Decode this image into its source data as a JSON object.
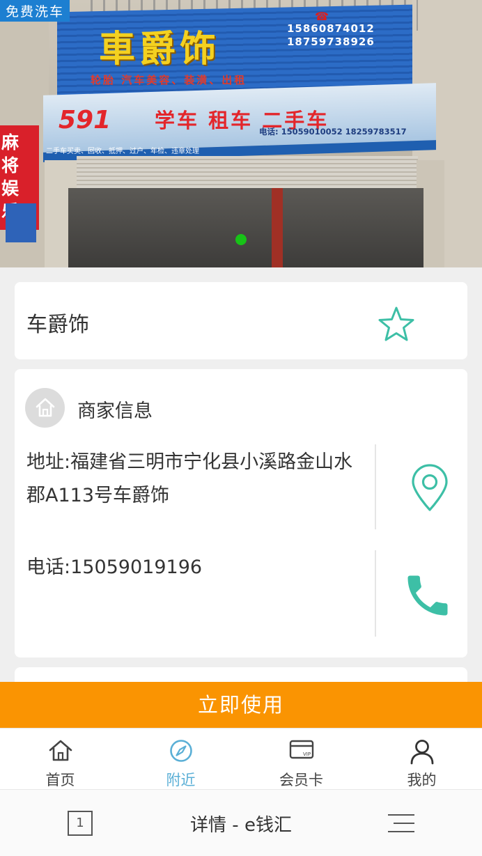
{
  "hero": {
    "tag": "免费洗车",
    "sign_title": "車爵饰",
    "sign_phones": [
      "15860874012",
      "18759738926"
    ],
    "sign_subtitle": "轮胎 汽车美容、装潢、出租",
    "sign_mid_591": "591",
    "sign_mid_title": "学车 租车 二手车",
    "sign_mid_services": "二手车买卖、回收、抵押、过户、年检、违章处理",
    "sign_mid_phones": "电话: 15059010052  18259783517",
    "left_board": "麻将娱乐"
  },
  "shop": {
    "name": "车爵饰",
    "favorite_icon": "star-outline-icon"
  },
  "info": {
    "title": "商家信息",
    "address": "地址:福建省三明市宁化县小溪路金山水郡A113号车爵饰",
    "phone": "电话:15059019196"
  },
  "action": {
    "use_now": "立即使用"
  },
  "tabs": [
    {
      "label": "首页",
      "icon": "home-icon"
    },
    {
      "label": "附近",
      "icon": "compass-icon",
      "active": true
    },
    {
      "label": "会员卡",
      "icon": "vip-card-icon"
    },
    {
      "label": "我的",
      "icon": "person-icon"
    }
  ],
  "browser": {
    "tab_count": "1",
    "page_title": "详情 - e钱汇"
  },
  "colors": {
    "accent": "#3dbfa6",
    "action": "#fa9402",
    "tab_active": "#5aafd6",
    "carousel_dot": "#17c317"
  }
}
